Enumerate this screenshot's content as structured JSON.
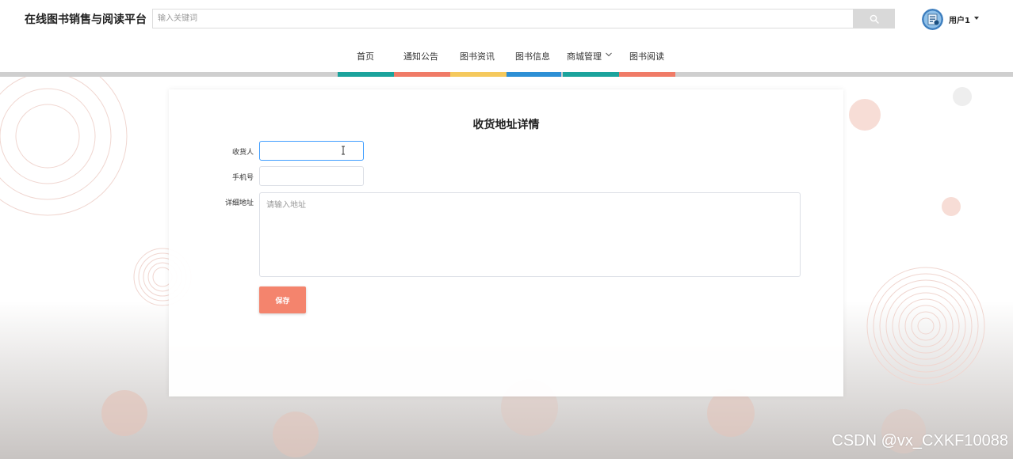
{
  "header": {
    "site_title": "在线图书销售与阅读平台",
    "search_placeholder": "输入关键词",
    "search_icon": "search-icon",
    "user_name": "用户1"
  },
  "nav": {
    "items": [
      {
        "label": "首页"
      },
      {
        "label": "通知公告"
      },
      {
        "label": "图书资讯"
      },
      {
        "label": "图书信息"
      },
      {
        "label": "商城管理",
        "has_dropdown": true
      },
      {
        "label": "图书阅读"
      }
    ],
    "bar_colors": [
      "#1ba39c",
      "#f07b67",
      "#f5c95d",
      "#2d8fd5",
      "#1ba39c",
      "#f07b67"
    ]
  },
  "form": {
    "title": "收货地址详情",
    "recipient_label": "收货人",
    "recipient_value": "",
    "phone_label": "手机号",
    "phone_value": "",
    "address_label": "详细地址",
    "address_placeholder": "请输入地址",
    "save_label": "保存"
  },
  "colors": {
    "accent": "#f4846d",
    "focus": "#409eff"
  },
  "watermark": "CSDN @vx_CXKF10088"
}
